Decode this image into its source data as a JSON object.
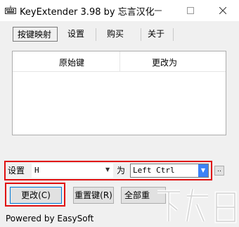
{
  "window": {
    "title": "KeyExtender 3.98 by 忘言汉化"
  },
  "tabs": [
    {
      "label": "按键映射"
    },
    {
      "label": "设置"
    },
    {
      "label": "购买"
    },
    {
      "label": "关于"
    }
  ],
  "table": {
    "columns": [
      "原始键",
      "更改为"
    ],
    "rows": []
  },
  "setting": {
    "label": "设置",
    "key_value": "H",
    "as_label": "为",
    "target_value": "Left Ctrl",
    "more_label": ".."
  },
  "buttons": {
    "change": "更改(C)",
    "reset": "重置键(R)",
    "reset_all": "全部重"
  },
  "status": "Powered by EasySoft",
  "watermark": "下载吧",
  "colors": {
    "highlight": "#e01010",
    "combo_arrow": "#3b82f6"
  }
}
